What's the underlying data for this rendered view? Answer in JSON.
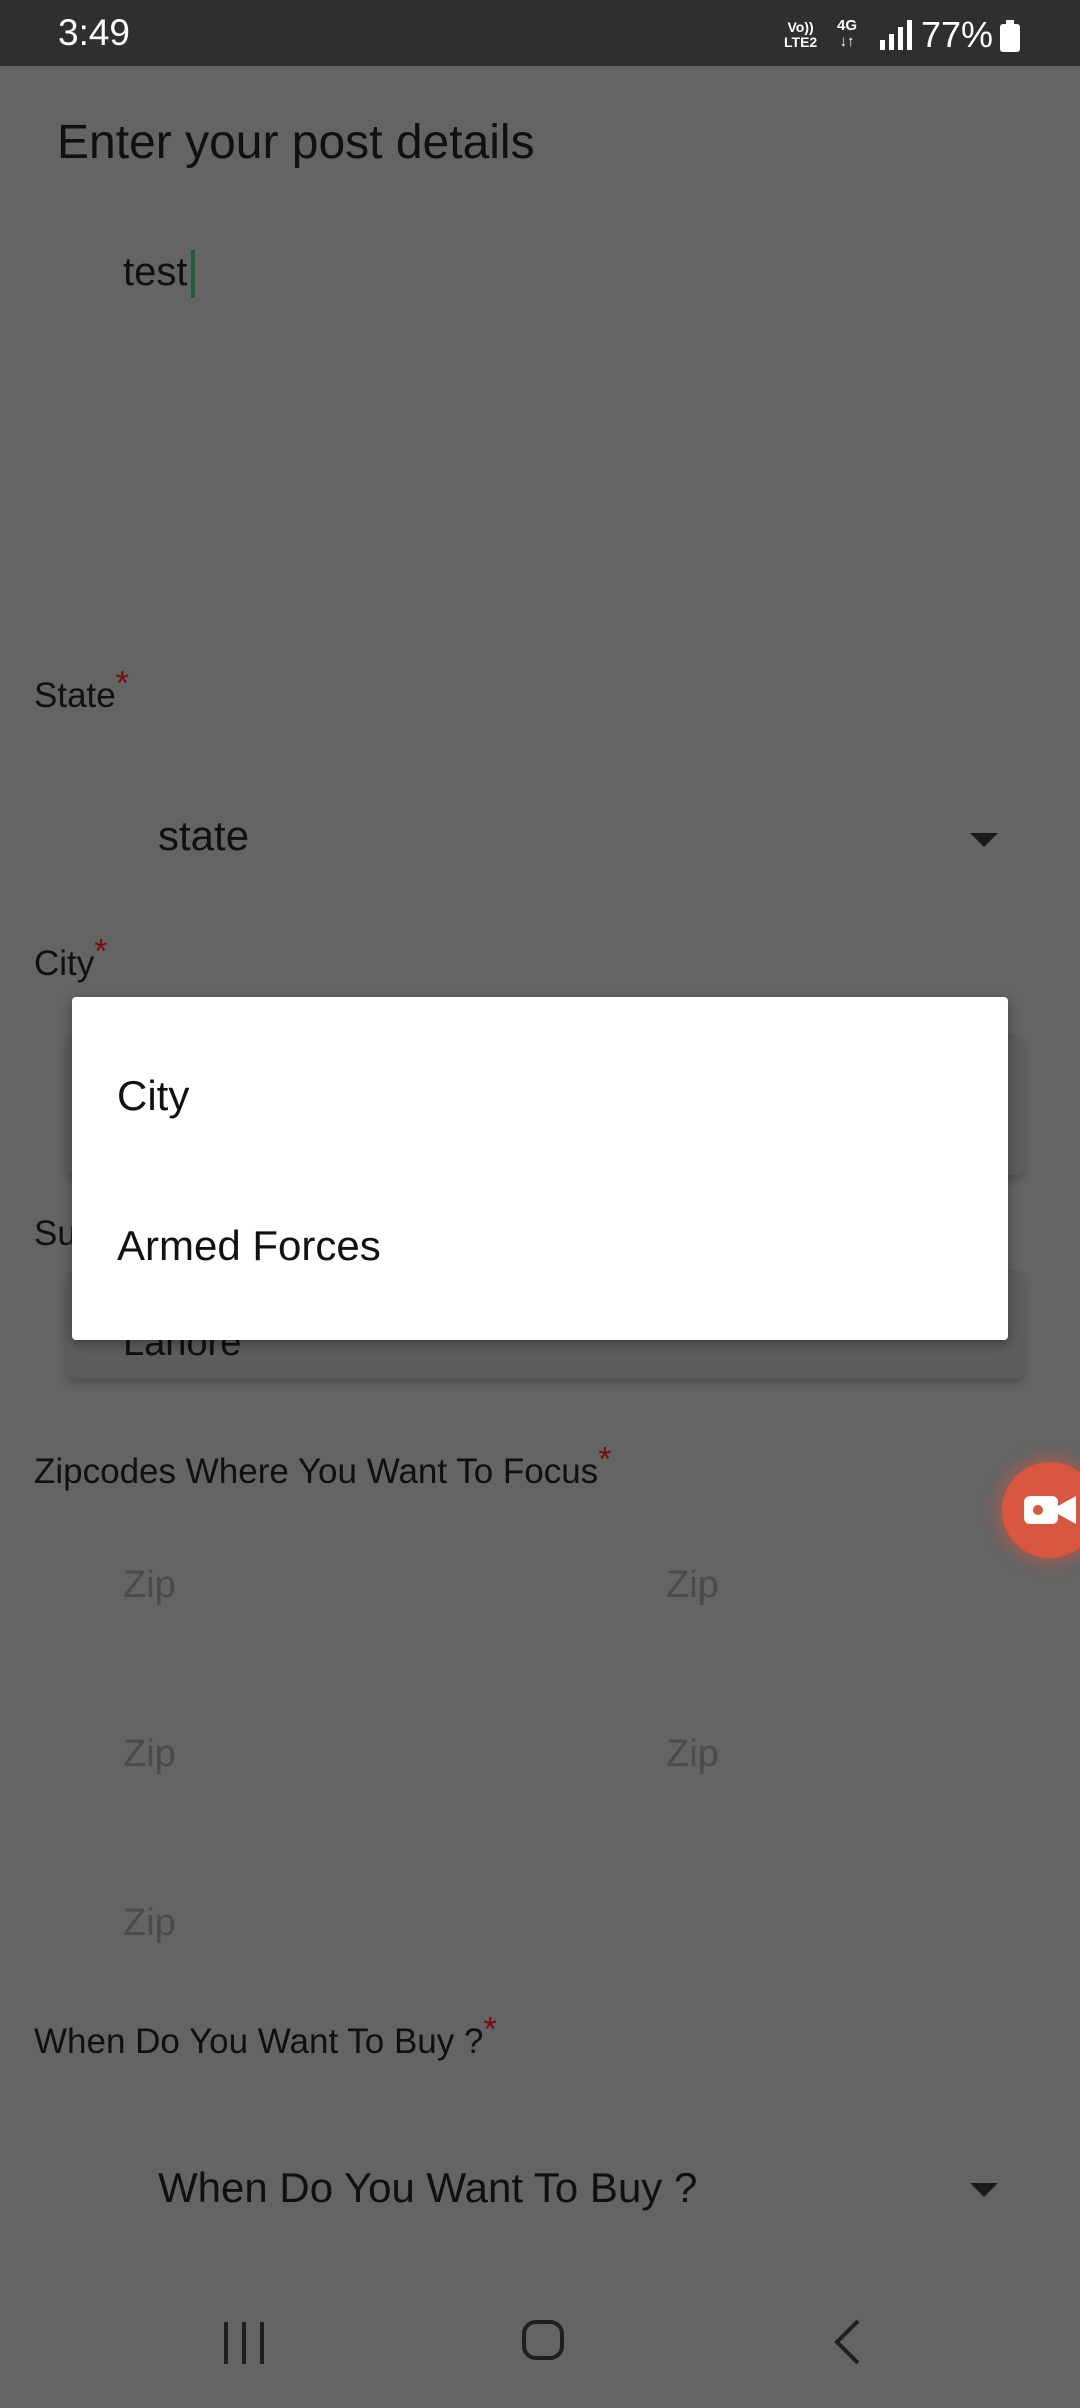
{
  "status_bar": {
    "time": "3:49",
    "volte_top": "Vo))",
    "volte_bottom": "LTE2",
    "net_top": "4G",
    "net_bottom": "↓↑",
    "battery_percent": "77%"
  },
  "page": {
    "title": "Enter your post details",
    "post_details_value": "test"
  },
  "state_field": {
    "label": "State",
    "required_mark": "*",
    "selected_value": "state"
  },
  "city_field": {
    "label": "City",
    "required_mark": "*"
  },
  "suburb_field": {
    "label_visible": "Su",
    "value_partial": "Lahore"
  },
  "zip_field": {
    "label": "Zipcodes Where You Want To Focus",
    "required_mark": "*",
    "placeholders": [
      "Zip",
      "Zip",
      "Zip",
      "Zip",
      "Zip"
    ]
  },
  "buy_field": {
    "label": "When Do You Want To Buy ?",
    "required_mark": "*",
    "selected_value": "When Do You Want To Buy ?"
  },
  "dropdown_menu": {
    "options": [
      "City",
      "Armed Forces"
    ]
  },
  "icons": {
    "dropdown_caret": "triangle-down-icon",
    "screen_record": "video-camera-icon",
    "nav_recents": "recents-icon",
    "nav_home": "home-icon",
    "nav_back": "back-icon"
  },
  "colors": {
    "scrim_background": "#646464",
    "status_bar": "#2f2f2f",
    "required_asterisk": "#7a0b0b",
    "menu_background": "#ffffff",
    "record_button": "#d9573e"
  }
}
